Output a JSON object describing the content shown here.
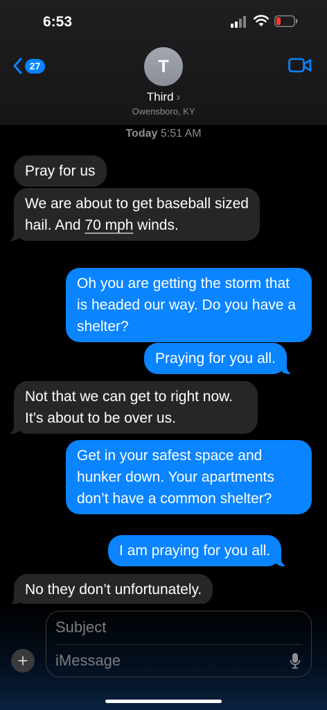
{
  "status": {
    "time": "6:53"
  },
  "header": {
    "back_count": "27",
    "avatar_initial": "T",
    "contact_name": "Third",
    "location": "Owensboro, KY"
  },
  "thread": {
    "day": "Today",
    "time": "5:51 AM"
  },
  "messages": [
    {
      "side": "in",
      "text": "Pray for us"
    },
    {
      "side": "in",
      "text_before": "We are about to get baseball sized hail. And ",
      "link": "70 mph",
      "text_after": " winds."
    },
    {
      "side": "out",
      "text": "Oh you are getting the storm that is headed our way. Do you have a shelter?"
    },
    {
      "side": "out",
      "text": "Praying for you all."
    },
    {
      "side": "in",
      "text": "Not that we can get to right now. It’s about to be over us."
    },
    {
      "side": "out",
      "text": "Get in your safest space and hunker down. Your apartments don’t have a common shelter?"
    },
    {
      "side": "out",
      "text": "I am praying for you all."
    },
    {
      "side": "in",
      "text": "No they don’t unfortunately."
    }
  ],
  "composer": {
    "subject_placeholder": "Subject",
    "message_placeholder": "iMessage"
  },
  "colors": {
    "outgoing": "#0a84ff",
    "incoming": "#262628",
    "background": "#000000"
  }
}
